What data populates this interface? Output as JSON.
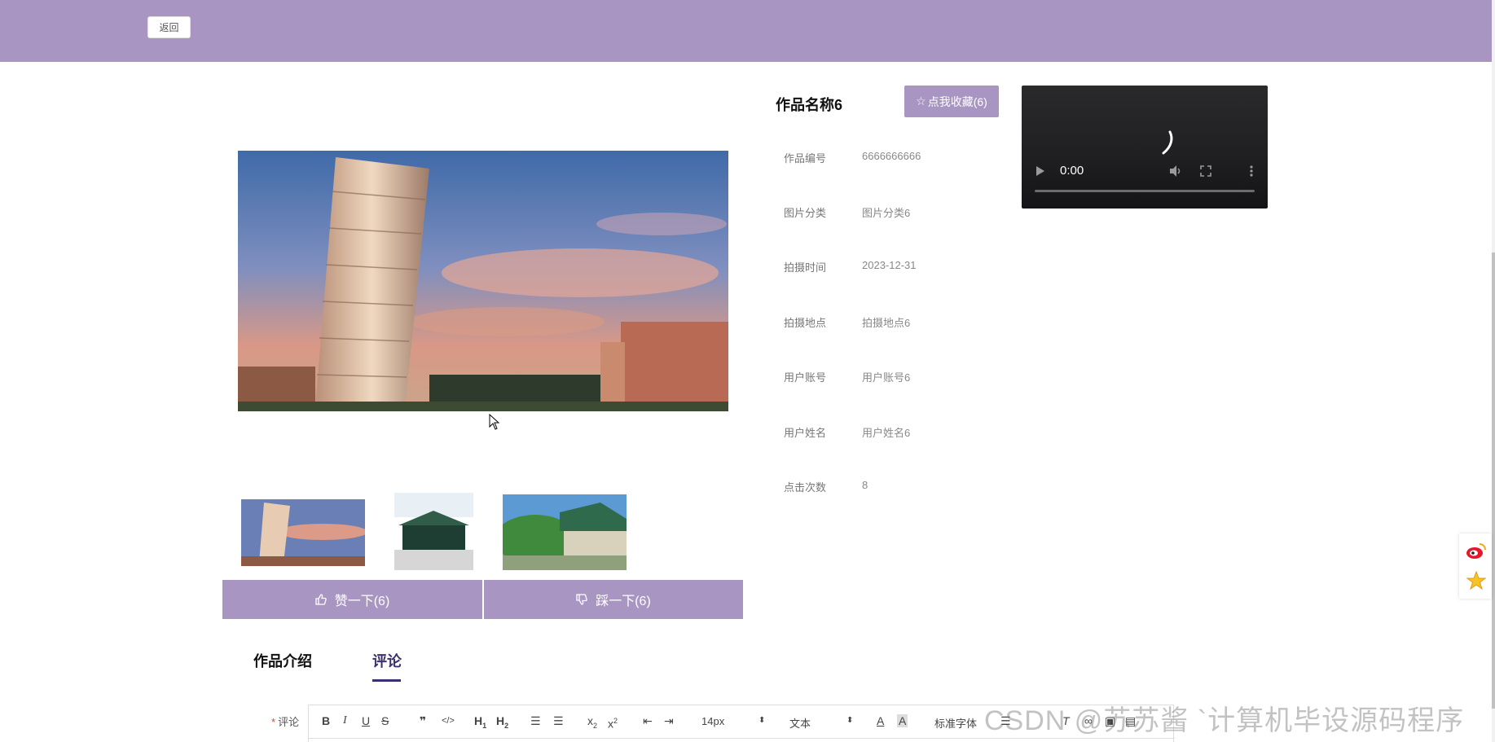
{
  "header": {
    "back_label": "返回"
  },
  "product": {
    "title": "作品名称6",
    "favorite_label": "点我收藏(6)",
    "details": [
      {
        "label": "作品编号",
        "value": "6666666666"
      },
      {
        "label": "图片分类",
        "value": "图片分类6"
      },
      {
        "label": "拍摄时间",
        "value": "2023-12-31"
      },
      {
        "label": "拍摄地点",
        "value": "拍摄地点6"
      },
      {
        "label": "用户账号",
        "value": "用户账号6"
      },
      {
        "label": "用户姓名",
        "value": "用户姓名6"
      },
      {
        "label": "点击次数",
        "value": "8"
      }
    ]
  },
  "video": {
    "time": "0:00"
  },
  "votes": {
    "like_label": "赞一下(6)",
    "dislike_label": "踩一下(6)"
  },
  "tabs": [
    {
      "label": "作品介绍",
      "active": false
    },
    {
      "label": "评论",
      "active": true
    }
  ],
  "comment": {
    "label": "评论",
    "toolbar": {
      "font_size": "14px",
      "paragraph": "文本",
      "font_family": "标准字体"
    }
  },
  "watermark": "CSDN @苏苏酱  `计算机毕设源码程序",
  "colors": {
    "accent": "#a895c2",
    "tab_active": "#3c2f6f"
  }
}
